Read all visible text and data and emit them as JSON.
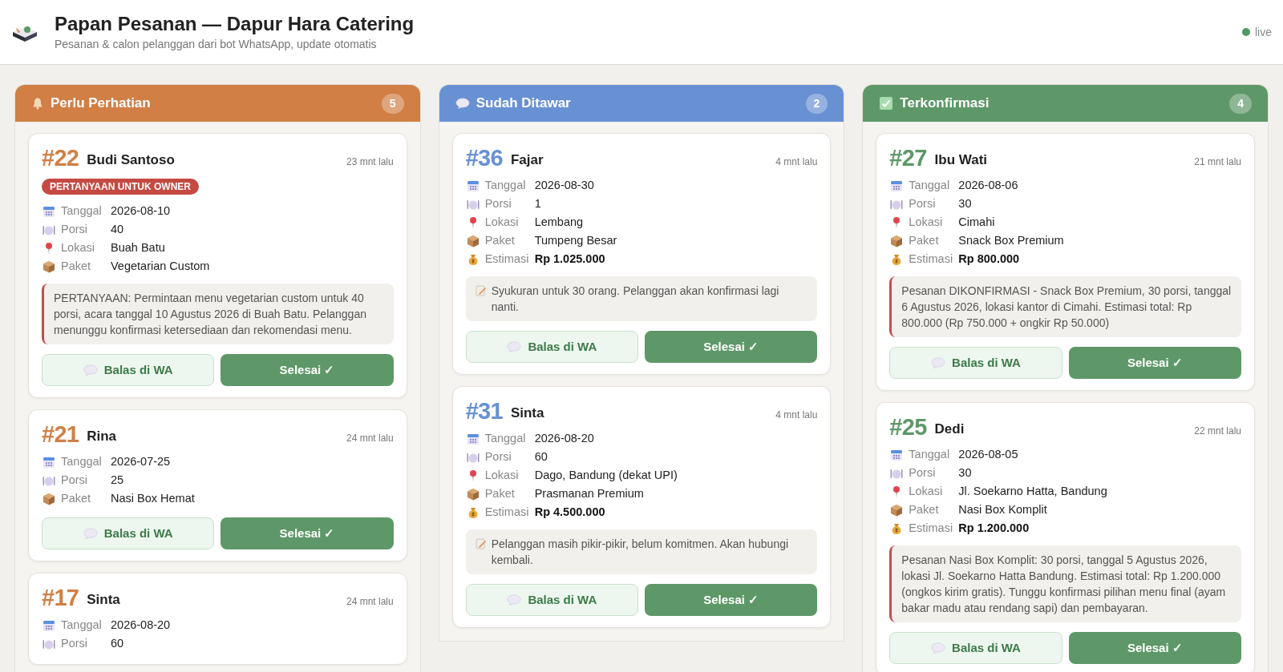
{
  "header": {
    "title": "Papan Pesanan — Dapur Hara Catering",
    "subtitle": "Pesanan & calon pelanggan dari bot WhatsApp, update otomatis",
    "status": {
      "label": "live",
      "color": "#4f9a5e"
    }
  },
  "columns": [
    {
      "title": "Perlu Perhatian",
      "kind": "bell",
      "color": "#d17f45",
      "count": "5",
      "cards": [
        {
          "number": "#22",
          "name": "Budi Santoso",
          "time": "23 mnt lalu",
          "badge": "PERTANYAAN UNTUK OWNER",
          "fields": [
            {
              "kind": "tanggal",
              "label": "Tanggal",
              "value": "2026-08-10"
            },
            {
              "kind": "porsi",
              "label": "Porsi",
              "value": "40"
            },
            {
              "kind": "lokasi",
              "label": "Lokasi",
              "value": "Buah Batu"
            },
            {
              "kind": "paket",
              "label": "Paket",
              "value": "Vegetarian Custom"
            }
          ],
          "note": {
            "kind": "flagged",
            "text": "PERTANYAAN: Permintaan menu vegetarian custom untuk 40 porsi, acara tanggal 10 Agustus 2026 di Buah Batu. Pelanggan menunggu konfirmasi ketersediaan dan rekomendasi menu."
          },
          "reply": "Balas di WA",
          "done": "Selesai ✓"
        },
        {
          "number": "#21",
          "name": "Rina",
          "time": "24 mnt lalu",
          "fields": [
            {
              "kind": "tanggal",
              "label": "Tanggal",
              "value": "2026-07-25"
            },
            {
              "kind": "porsi",
              "label": "Porsi",
              "value": "25"
            },
            {
              "kind": "paket",
              "label": "Paket",
              "value": "Nasi Box Hemat"
            }
          ],
          "reply": "Balas di WA",
          "done": "Selesai ✓"
        },
        {
          "number": "#17",
          "name": "Sinta",
          "time": "24 mnt lalu",
          "fields": [
            {
              "kind": "tanggal",
              "label": "Tanggal",
              "value": "2026-08-20"
            },
            {
              "kind": "porsi",
              "label": "Porsi",
              "value": "60"
            }
          ]
        }
      ]
    },
    {
      "title": "Sudah Ditawar",
      "kind": "speech",
      "color": "#6891d4",
      "count": "2",
      "cards": [
        {
          "number": "#36",
          "name": "Fajar",
          "time": "4 mnt lalu",
          "fields": [
            {
              "kind": "tanggal",
              "label": "Tanggal",
              "value": "2026-08-30"
            },
            {
              "kind": "porsi",
              "label": "Porsi",
              "value": "1"
            },
            {
              "kind": "lokasi",
              "label": "Lokasi",
              "value": "Lembang"
            },
            {
              "kind": "paket",
              "label": "Paket",
              "value": "Tumpeng Besar"
            },
            {
              "kind": "estimasi",
              "label": "Estimasi",
              "value": "Rp 1.025.000"
            }
          ],
          "note": {
            "kind": "memo",
            "text": "Syukuran untuk 30 orang. Pelanggan akan konfirmasi lagi nanti."
          },
          "reply": "Balas di WA",
          "done": "Selesai ✓"
        },
        {
          "number": "#31",
          "name": "Sinta",
          "time": "4 mnt lalu",
          "fields": [
            {
              "kind": "tanggal",
              "label": "Tanggal",
              "value": "2026-08-20"
            },
            {
              "kind": "porsi",
              "label": "Porsi",
              "value": "60"
            },
            {
              "kind": "lokasi",
              "label": "Lokasi",
              "value": "Dago, Bandung (dekat UPI)"
            },
            {
              "kind": "paket",
              "label": "Paket",
              "value": "Prasmanan Premium"
            },
            {
              "kind": "estimasi",
              "label": "Estimasi",
              "value": "Rp 4.500.000"
            }
          ],
          "note": {
            "kind": "memo",
            "text": "Pelanggan masih pikir-pikir, belum komitmen. Akan hubungi kembali."
          },
          "reply": "Balas di WA",
          "done": "Selesai ✓"
        }
      ]
    },
    {
      "title": "Terkonfirmasi",
      "kind": "check",
      "color": "#5e9868",
      "count": "4",
      "cards": [
        {
          "number": "#27",
          "name": "Ibu Wati",
          "time": "21 mnt lalu",
          "fields": [
            {
              "kind": "tanggal",
              "label": "Tanggal",
              "value": "2026-08-06"
            },
            {
              "kind": "porsi",
              "label": "Porsi",
              "value": "30"
            },
            {
              "kind": "lokasi",
              "label": "Lokasi",
              "value": "Cimahi"
            },
            {
              "kind": "paket",
              "label": "Paket",
              "value": "Snack Box Premium"
            },
            {
              "kind": "estimasi",
              "label": "Estimasi",
              "value": "Rp 800.000"
            }
          ],
          "note": {
            "kind": "flagged",
            "text": "Pesanan DIKONFIRMASI - Snack Box Premium, 30 porsi, tanggal 6 Agustus 2026, lokasi kantor di Cimahi. Estimasi total: Rp 800.000 (Rp 750.000 + ongkir Rp 50.000)"
          },
          "reply": "Balas di WA",
          "done": "Selesai ✓"
        },
        {
          "number": "#25",
          "name": "Dedi",
          "time": "22 mnt lalu",
          "fields": [
            {
              "kind": "tanggal",
              "label": "Tanggal",
              "value": "2026-08-05"
            },
            {
              "kind": "porsi",
              "label": "Porsi",
              "value": "30"
            },
            {
              "kind": "lokasi",
              "label": "Lokasi",
              "value": "Jl. Soekarno Hatta, Bandung"
            },
            {
              "kind": "paket",
              "label": "Paket",
              "value": "Nasi Box Komplit"
            },
            {
              "kind": "estimasi",
              "label": "Estimasi",
              "value": "Rp 1.200.000"
            }
          ],
          "note": {
            "kind": "flagged",
            "text": "Pesanan Nasi Box Komplit: 30 porsi, tanggal 5 Agustus 2026, lokasi Jl. Soekarno Hatta Bandung. Estimasi total: Rp 1.200.000 (ongkos kirim gratis). Tunggu konfirmasi pilihan menu final (ayam bakar madu atau rendang sapi) dan pembayaran."
          },
          "reply": "Balas di WA",
          "done": "Selesai ✓"
        }
      ]
    }
  ]
}
